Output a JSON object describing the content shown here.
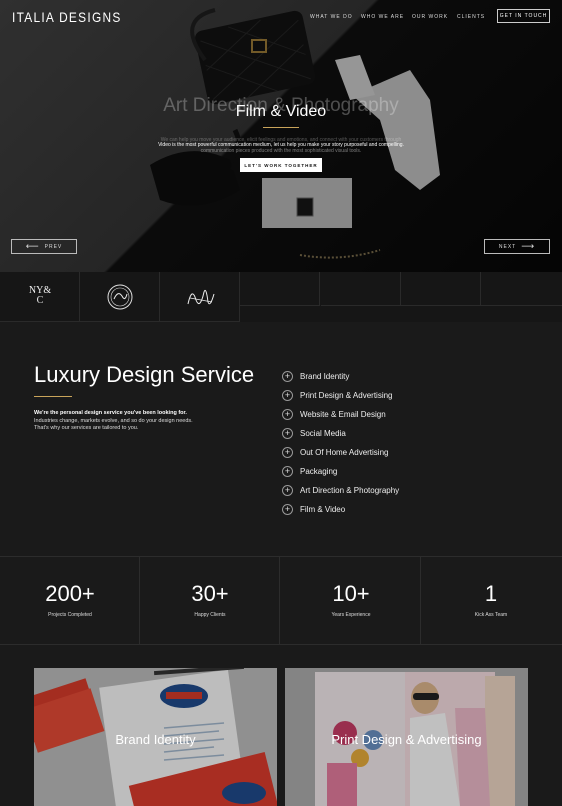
{
  "brand": {
    "logo_text": "ITALIA DESIGNS"
  },
  "nav": {
    "items": [
      "WHAT WE DO",
      "WHO WE ARE",
      "OUR WORK",
      "CLIENTS"
    ],
    "cta": "GET IN TOUCH"
  },
  "hero": {
    "ghost_title": "Art Direction & Photography",
    "title": "Film & Video",
    "ghost_text": "We can help you move your audience, elicit feelings and emotions, and connect with your customers through",
    "text_line1": "Video is the most powerful communication medium, let us help you make your story purposeful and compelling.",
    "text_line2": "communication pieces produced with the most sophisticated visual tools.",
    "cta": "LET'S WORK TOGETHER",
    "prev": "PREV",
    "next": "NEXT",
    "arrow_left": "⟵",
    "arrow_right": "⟶"
  },
  "clients": {
    "logo1": "NY&C"
  },
  "services": {
    "title": "Luxury Design Service",
    "lead": "We're the personal design service you've been looking for.",
    "desc": "Industries change, markets evolve, and so do your design needs. That's why our services are tailored to you.",
    "items": [
      "Brand Identity",
      "Print Design & Advertising",
      "Website & Email Design",
      "Social Media",
      "Out Of Home Advertising",
      "Packaging",
      "Art Direction & Photography",
      "Film & Video"
    ],
    "plus_glyph": "+"
  },
  "stats": [
    {
      "value": "200+",
      "label": "Projects Completed"
    },
    {
      "value": "30+",
      "label": "Happy Clients"
    },
    {
      "value": "10+",
      "label": "Years Experience"
    },
    {
      "value": "1",
      "label": "Kick Ass Team"
    }
  ],
  "portfolio": [
    {
      "title": "Brand Identity"
    },
    {
      "title": "Print Design & Advertising"
    }
  ],
  "colors": {
    "accent": "#c9a45a",
    "background": "#1a1a1a",
    "text": "#ffffff"
  }
}
